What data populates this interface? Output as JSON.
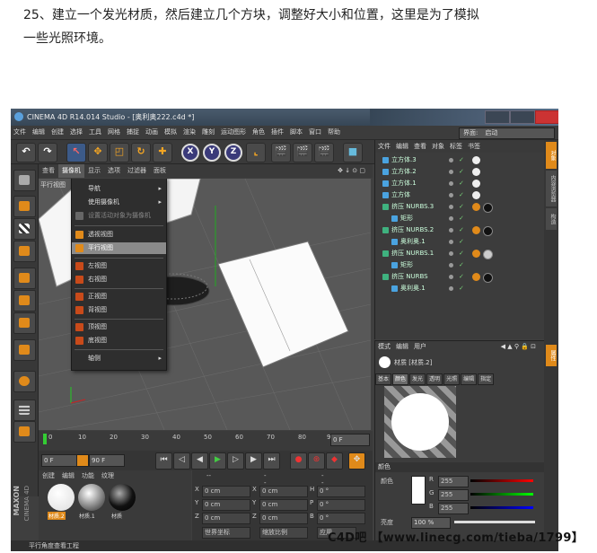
{
  "caption": {
    "line1": "25、建立一个发光材质，然后建立几个方块，调整好大小和位置，这里是为了模拟",
    "line2": "一些光照环境。"
  },
  "app": {
    "title": "CINEMA 4D R14.014 Studio - [奥利奥222.c4d *]",
    "menu": [
      "文件",
      "编辑",
      "创建",
      "选择",
      "工具",
      "网格",
      "捕捉",
      "动画",
      "模拟",
      "渲染",
      "雕刻",
      "运动图形",
      "角色",
      "插件",
      "脚本",
      "窗口",
      "帮助"
    ],
    "interface_label": "界面:",
    "interface_value": "启动",
    "toolbar_axes": [
      "X",
      "Y",
      "Z"
    ]
  },
  "viewport": {
    "menu": [
      "查看",
      "摄像机",
      "显示",
      "选项",
      "过滤器",
      "面板"
    ],
    "label": "平行视图",
    "dropdown": [
      {
        "label": "导航",
        "arrow": "▸",
        "icon": ""
      },
      {
        "label": "使用摄像机",
        "arrow": "▸",
        "icon": ""
      },
      {
        "label": "设置活动对象为摄像机",
        "arrow": "",
        "icon": "#666"
      },
      {
        "label": "透视视图",
        "arrow": "",
        "icon": "#e08a1a"
      },
      {
        "label": "平行视图",
        "arrow": "",
        "icon": "#e08a1a"
      },
      {
        "label": "左视图",
        "arrow": "",
        "icon": "#c84a1a"
      },
      {
        "label": "右视图",
        "arrow": "",
        "icon": "#c84a1a"
      },
      {
        "label": "正视图",
        "arrow": "",
        "icon": "#c84a1a"
      },
      {
        "label": "背视图",
        "arrow": "",
        "icon": "#c84a1a"
      },
      {
        "label": "顶视图",
        "arrow": "",
        "icon": "#c84a1a"
      },
      {
        "label": "底视图",
        "arrow": "",
        "icon": "#c84a1a"
      },
      {
        "label": "轴侧",
        "arrow": "▸",
        "icon": ""
      }
    ]
  },
  "timeline": {
    "ticks": [
      "0",
      "10",
      "20",
      "30",
      "40",
      "50",
      "60",
      "70",
      "80",
      "90"
    ],
    "frame": "0 F",
    "start": "0 F",
    "end": "90 F"
  },
  "materials": {
    "tabs": [
      "创建",
      "编辑",
      "功能",
      "纹理"
    ],
    "items": [
      "材质.2",
      "材质.1",
      "材质"
    ]
  },
  "coords": {
    "header": [
      "--",
      "--",
      "--"
    ],
    "rows": [
      {
        "a": "X",
        "av": "0 cm",
        "b": "X",
        "bv": "0 cm",
        "c": "H",
        "cv": "0 °"
      },
      {
        "a": "Y",
        "av": "0 cm",
        "b": "Y",
        "bv": "0 cm",
        "c": "P",
        "cv": "0 °"
      },
      {
        "a": "Z",
        "av": "0 cm",
        "b": "Z",
        "bv": "0 cm",
        "c": "B",
        "cv": "0 °"
      }
    ],
    "mode1": "世界坐标",
    "mode2": "缩放比例",
    "apply": "应用"
  },
  "objects": {
    "menu": [
      "文件",
      "编辑",
      "查看",
      "对象",
      "标签",
      "书签"
    ],
    "rows": [
      {
        "name": "立方体.3",
        "indent": 0,
        "icon": "#4aa3e0",
        "tag": "#eee",
        "tag2": ""
      },
      {
        "name": "立方体.2",
        "indent": 0,
        "icon": "#4aa3e0",
        "tag": "#eee",
        "tag2": ""
      },
      {
        "name": "立方体.1",
        "indent": 0,
        "icon": "#4aa3e0",
        "tag": "#eee",
        "tag2": ""
      },
      {
        "name": "立方体",
        "indent": 0,
        "icon": "#4aa3e0",
        "tag": "#eee",
        "tag2": ""
      },
      {
        "name": "挤压 NURBS.3",
        "indent": 0,
        "icon": "#3fb27f",
        "tag": "#e08a1a",
        "tag2": "#111"
      },
      {
        "name": "矩形",
        "indent": 1,
        "icon": "#4aa3e0",
        "tag": "",
        "tag2": ""
      },
      {
        "name": "挤压 NURBS.2",
        "indent": 0,
        "icon": "#3fb27f",
        "tag": "#e08a1a",
        "tag2": "#111"
      },
      {
        "name": "奥利奥.1",
        "indent": 1,
        "icon": "#4aa3e0",
        "tag": "",
        "tag2": ""
      },
      {
        "name": "挤压 NURBS.1",
        "indent": 0,
        "icon": "#3fb27f",
        "tag": "#e08a1a",
        "tag2": "#ccc"
      },
      {
        "name": "矩形",
        "indent": 1,
        "icon": "#4aa3e0",
        "tag": "",
        "tag2": ""
      },
      {
        "name": "挤压 NURBS",
        "indent": 0,
        "icon": "#3fb27f",
        "tag": "#e08a1a",
        "tag2": "#111"
      },
      {
        "name": "奥利奥.1",
        "indent": 1,
        "icon": "#4aa3e0",
        "tag": "",
        "tag2": ""
      }
    ]
  },
  "attributes": {
    "menu": [
      "模式",
      "编辑",
      "用户"
    ],
    "material_name": "材质 [材质.2]",
    "tabs": [
      "基本",
      "颜色",
      "发光",
      "透明",
      "光照",
      "编辑",
      "指定"
    ],
    "active_tab": "颜色",
    "section": "颜色",
    "color_label": "颜色",
    "r_label": "R",
    "r": "255",
    "g_label": "G",
    "g": "255",
    "b_label": "B",
    "b": "255",
    "brightness_label": "亮度",
    "brightness": "100 %"
  },
  "right_strip": [
    "对象",
    "内容浏览器",
    "构造",
    "属性"
  ],
  "status": "平行角度查看工程",
  "brand": [
    "MAXON",
    "CINEMA 4D"
  ],
  "watermark": "C4D吧 【www.linecg.com/tieba/1799】"
}
